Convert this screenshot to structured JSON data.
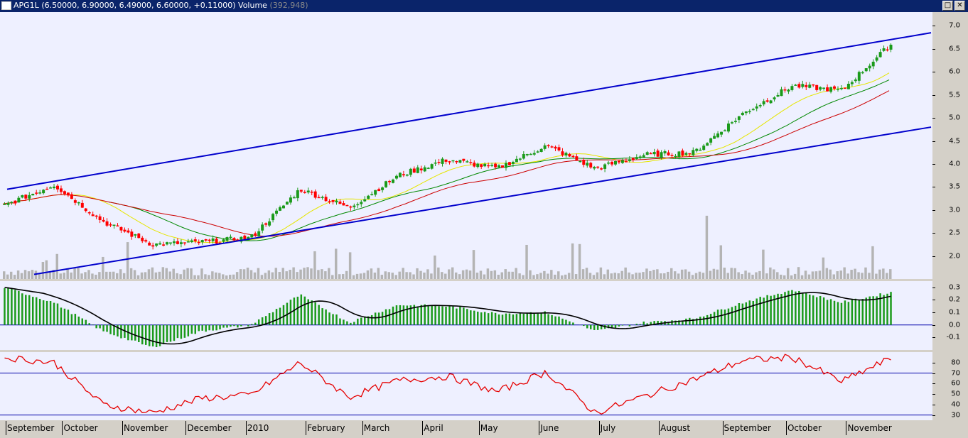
{
  "window": {
    "symbol": "APG1L",
    "ohlc_text": "(6.50000, 6.90000, 6.49000, 6.60000, +0.11000)",
    "volume_label": "Volume",
    "volume_value": "(392,948)",
    "buttons": [
      "□",
      "✕"
    ]
  },
  "x_axis": {
    "months": [
      "September",
      "October",
      "November",
      "December",
      "2010",
      "February",
      "March",
      "April",
      "May",
      "June",
      "July",
      "August",
      "September",
      "October",
      "November"
    ]
  },
  "colors": {
    "background": "#eef0ff",
    "candle_up": "#1a9a1a",
    "candle_down": "#ff0000",
    "trend_channel": "#0000cc",
    "ma_long": "#cc0000",
    "ma_mid": "#008800",
    "ma_short": "#e6e600",
    "volume": "#b4b4b4",
    "macd_hist": "#1a9a1a",
    "macd_signal": "#000000",
    "rsi_line": "#e60000",
    "rsi_levels": "#0000aa"
  },
  "chart_data": [
    {
      "type": "candlestick",
      "symbol": "APG1L",
      "ylim": [
        1.5,
        7.3
      ],
      "yticks": [
        2.0,
        2.5,
        3.0,
        3.5,
        4.0,
        4.5,
        5.0,
        5.5,
        6.0,
        6.5,
        7.0
      ],
      "x": [
        "September",
        "October",
        "November",
        "December",
        "2010",
        "February",
        "March",
        "April",
        "May",
        "June",
        "July",
        "August",
        "September",
        "October",
        "November"
      ],
      "close": [
        3.1,
        3.55,
        2.75,
        2.25,
        2.3,
        2.4,
        3.45,
        3.05,
        3.75,
        4.1,
        3.9,
        4.4,
        3.9,
        4.2,
        4.25,
        5.1,
        5.7,
        5.6,
        6.6
      ],
      "last_bar": {
        "open": 6.5,
        "high": 6.9,
        "low": 6.49,
        "close": 6.6,
        "change": 0.11
      },
      "volume_last": 392948,
      "overlays": [
        "moving_average_long",
        "moving_average_mid",
        "moving_average_short",
        "trend_channel_upper",
        "trend_channel_lower"
      ]
    },
    {
      "type": "bar",
      "name": "MACD",
      "ylim": [
        -0.2,
        0.35
      ],
      "yticks": [
        -0.1,
        0.0,
        0.1,
        0.2,
        0.3
      ],
      "values": [
        0.3,
        0.18,
        -0.05,
        -0.18,
        -0.05,
        0.0,
        0.24,
        0.02,
        0.16,
        0.15,
        0.09,
        0.1,
        -0.05,
        0.02,
        0.05,
        0.18,
        0.28,
        0.18,
        0.26
      ]
    },
    {
      "type": "line",
      "name": "RSI",
      "ylim": [
        25,
        90
      ],
      "yticks": [
        30,
        40,
        50,
        60,
        70,
        80
      ],
      "levels": [
        70,
        30
      ],
      "values": [
        85,
        80,
        40,
        32,
        46,
        49,
        80,
        47,
        63,
        67,
        52,
        71,
        32,
        48,
        64,
        82,
        85,
        62,
        84
      ]
    }
  ]
}
